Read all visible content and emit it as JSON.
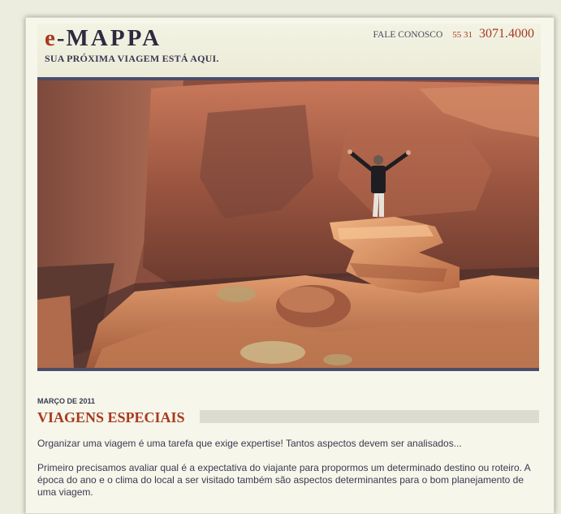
{
  "header": {
    "logo_e": "e",
    "logo_dash": "-",
    "logo_name": "MAPPA",
    "tagline": "SUA PRÓXIMA VIAGEM ESTÁ AQUI.",
    "contact_label": "FALE CONOSCO",
    "phone_area": "55 31",
    "phone_number": "3071.4000"
  },
  "hero": {
    "icon": "canyon-photo"
  },
  "post": {
    "date": "MARÇO DE 2011",
    "title": "VIAGENS ESPECIAIS",
    "paragraph1": "Organizar uma viagem é uma tarefa que exige expertise! Tantos aspectos devem ser analisados...",
    "paragraph2": "Primeiro precisamos avaliar qual é a expectativa do viajante para propormos um determinado destino ou roteiro. A época do ano e o clima do local a ser visitado também são aspectos determinantes para o bom planejamento de uma viagem."
  },
  "colors": {
    "accent": "#a8391f",
    "text": "#3a3a52",
    "frame": "#4c4c6a"
  }
}
